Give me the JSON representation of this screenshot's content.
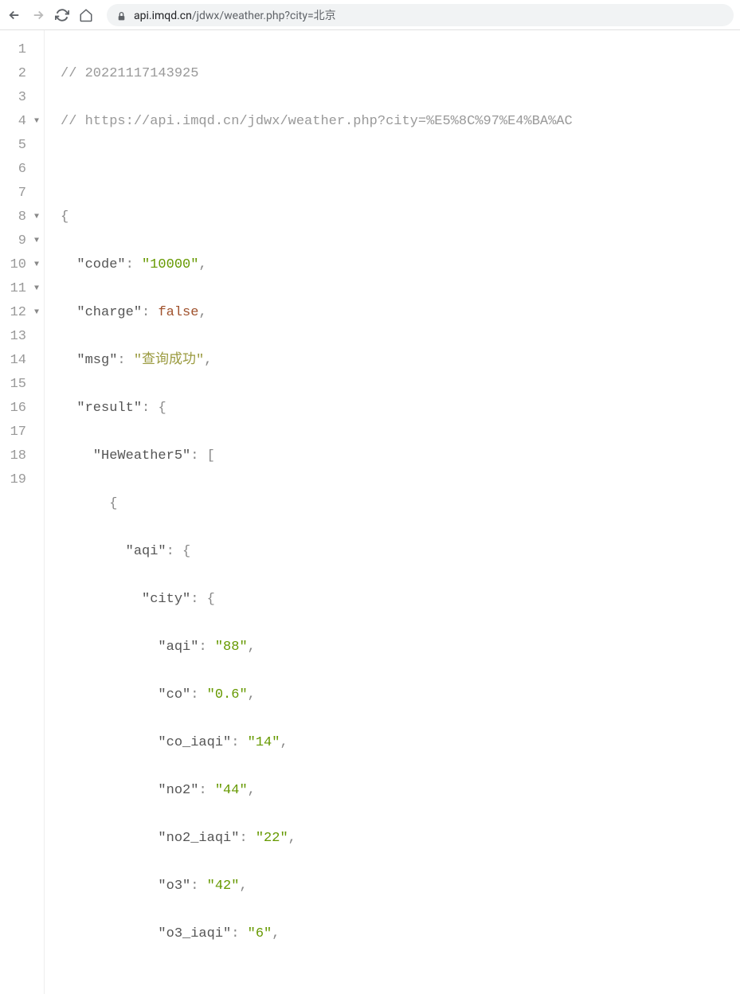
{
  "browser": {
    "url_domain": "api.imqd.cn",
    "url_path": "/jdwx/weather.php?city=北京"
  },
  "code": {
    "comment1": "// 20221117143925",
    "comment2": "// https://api.imqd.cn/jdwx/weather.php?city=%E5%8C%97%E4%BA%AC",
    "key_code": "\"code\"",
    "val_code": "\"10000\"",
    "key_charge": "\"charge\"",
    "val_charge": "false",
    "key_msg": "\"msg\"",
    "val_msg": "\"查询成功\"",
    "key_result": "\"result\"",
    "key_heweather": "\"HeWeather5\"",
    "key_aqi": "\"aqi\"",
    "key_city": "\"city\"",
    "key_aqi2": "\"aqi\"",
    "val_aqi2": "\"88\"",
    "key_co": "\"co\"",
    "val_co": "\"0.6\"",
    "key_co_iaqi": "\"co_iaqi\"",
    "val_co_iaqi": "\"14\"",
    "key_no2": "\"no2\"",
    "val_no2": "\"44\"",
    "key_no2_iaqi": "\"no2_iaqi\"",
    "val_no2_iaqi": "\"22\"",
    "key_o3": "\"o3\"",
    "val_o3": "\"42\"",
    "key_o3_iaqi": "\"o3_iaqi\"",
    "val_o3_iaqi": "\"6\""
  },
  "lines": {
    "l1": "1",
    "l2": "2",
    "l3": "3",
    "l4": "4",
    "l5": "5",
    "l6": "6",
    "l7": "7",
    "l8": "8",
    "l9": "9",
    "l10": "10",
    "l11": "11",
    "l12": "12",
    "l13": "13",
    "l14": "14",
    "l15": "15",
    "l16": "16",
    "l17": "17",
    "l18": "18",
    "l19": "19"
  }
}
